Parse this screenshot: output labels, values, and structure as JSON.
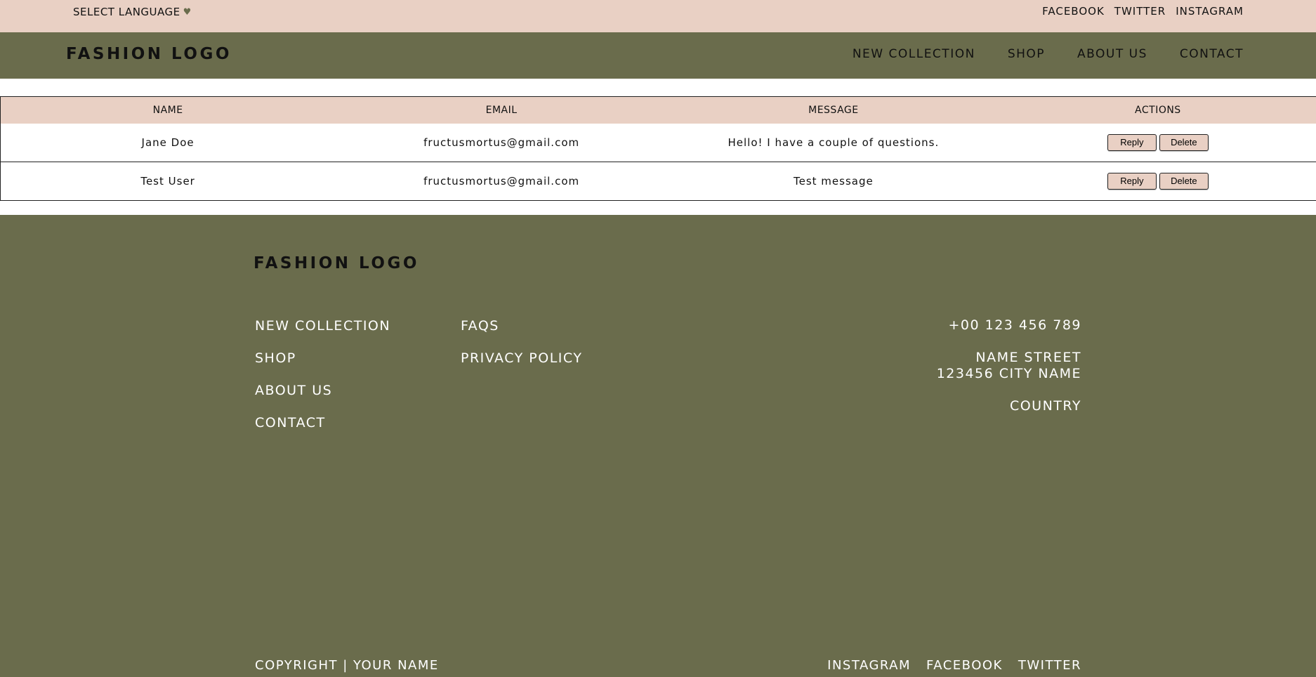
{
  "topbar": {
    "language_label": "SELECT LANGUAGE",
    "language_icon": "♥",
    "social": [
      "FACEBOOK",
      "TWITTER",
      "INSTAGRAM"
    ]
  },
  "header": {
    "logo": "FASHION LOGO",
    "nav": [
      "NEW COLLECTION",
      "SHOP",
      "ABOUT US",
      "CONTACT"
    ]
  },
  "table": {
    "headers": [
      "NAME",
      "EMAIL",
      "MESSAGE",
      "ACTIONS"
    ],
    "rows": [
      {
        "name": "Jane Doe",
        "email": "fructusmortus@gmail.com",
        "message": "Hello! I have a couple of questions."
      },
      {
        "name": "Test User",
        "email": "fructusmortus@gmail.com",
        "message": "Test message"
      }
    ],
    "reply_label": "Reply",
    "delete_label": "Delete"
  },
  "footer": {
    "logo": "FASHION LOGO",
    "col1": [
      "NEW COLLECTION",
      "SHOP",
      "ABOUT US",
      "CONTACT"
    ],
    "col2": [
      "FAQS",
      "PRIVACY POLICY"
    ],
    "phone": "+00 123 456 789",
    "street": "NAME STREET",
    "city": "123456 CITY NAME",
    "country": "COUNTRY",
    "copyright": "COPYRIGHT | YOUR NAME",
    "social": [
      "INSTAGRAM",
      "FACEBOOK",
      "TWITTER"
    ]
  },
  "colors": {
    "blush": "#e9d0c4",
    "olive": "#6a6c4c"
  }
}
